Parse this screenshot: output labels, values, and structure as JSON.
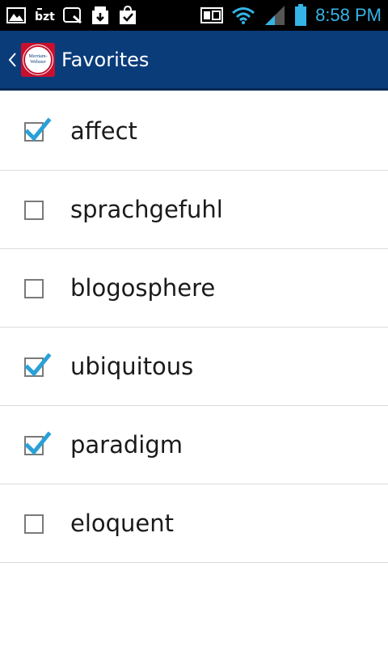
{
  "status_bar": {
    "time": "8:58 PM",
    "left_icons": [
      "gallery-icon",
      "bzt-icon",
      "search-notification-icon",
      "download-icon",
      "shopping-bag-icon"
    ],
    "right_icons": [
      "screen-mirror-icon",
      "wifi-icon",
      "signal-icon",
      "battery-icon"
    ]
  },
  "action_bar": {
    "title": "Favorites",
    "logo_text": "Merriam-Webster"
  },
  "favorites": [
    {
      "word": "affect",
      "checked": true
    },
    {
      "word": "sprachgefuhl",
      "checked": false
    },
    {
      "word": "blogosphere",
      "checked": false
    },
    {
      "word": "ubiquitous",
      "checked": true
    },
    {
      "word": "paradigm",
      "checked": true
    },
    {
      "word": "eloquent",
      "checked": false
    }
  ],
  "colors": {
    "action_bar": "#0b3c7a",
    "checkmark": "#2aa0d8",
    "status_time": "#35b4e6"
  }
}
